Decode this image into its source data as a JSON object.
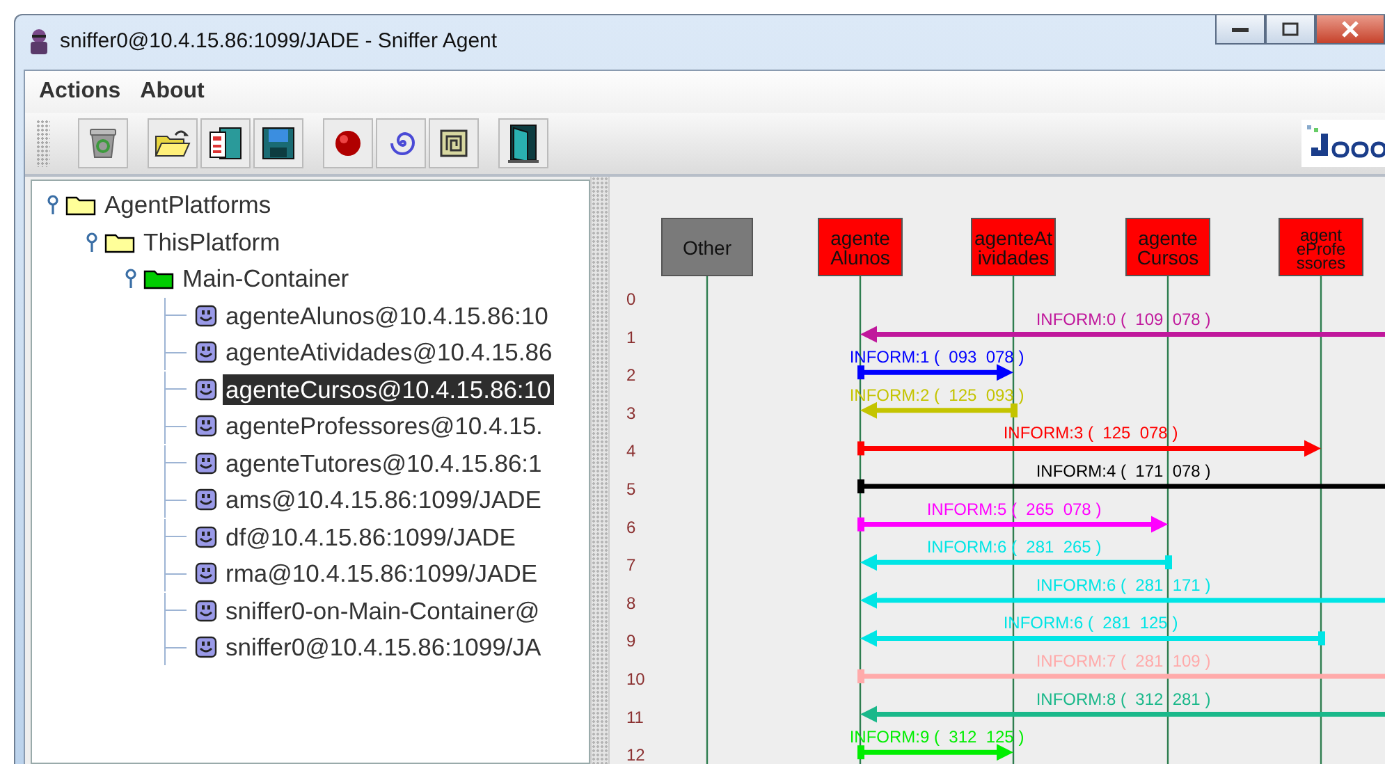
{
  "window": {
    "title": "sniffer0@10.4.15.86:1099/JADE - Sniffer Agent"
  },
  "menu": [
    "Actions",
    "About"
  ],
  "toolbar": [
    {
      "kind": "trash"
    },
    {
      "kind": "open",
      "group_start": true
    },
    {
      "kind": "document"
    },
    {
      "kind": "floppy"
    },
    {
      "kind": "record",
      "group_start": true
    },
    {
      "kind": "spiral"
    },
    {
      "kind": "square-spiral"
    },
    {
      "kind": "door",
      "group_start": true
    }
  ],
  "tree": [
    {
      "label": "AgentPlatforms",
      "kind": "folder",
      "expanded": true,
      "selected": false,
      "children": [
        {
          "label": "ThisPlatform",
          "kind": "folder",
          "expanded": true,
          "selected": false,
          "children": [
            {
              "label": "Main-Container",
              "kind": "container",
              "expanded": true,
              "selected": false,
              "children": [
                {
                  "label": "agenteAlunos@10.4.15.86:10",
                  "kind": "agent",
                  "selected": false
                },
                {
                  "label": "agenteAtividades@10.4.15.86",
                  "kind": "agent",
                  "selected": false
                },
                {
                  "label": "agenteCursos@10.4.15.86:10",
                  "kind": "agent",
                  "selected": true
                },
                {
                  "label": "agenteProfessores@10.4.15.",
                  "kind": "agent",
                  "selected": false
                },
                {
                  "label": "agenteTutores@10.4.15.86:1",
                  "kind": "agent",
                  "selected": false
                },
                {
                  "label": "ams@10.4.15.86:1099/JADE",
                  "kind": "agent",
                  "selected": false
                },
                {
                  "label": "df@10.4.15.86:1099/JADE",
                  "kind": "agent",
                  "selected": false
                },
                {
                  "label": "rma@10.4.15.86:1099/JADE",
                  "kind": "agent",
                  "selected": false
                },
                {
                  "label": "sniffer0-on-Main-Container@",
                  "kind": "agent",
                  "selected": false
                },
                {
                  "label": "sniffer0@10.4.15.86:1099/JA",
                  "kind": "agent",
                  "selected": false
                }
              ]
            }
          ]
        }
      ]
    }
  ],
  "diagram": {
    "agents": [
      {
        "name_lines": [
          "Other"
        ],
        "kind": "other"
      },
      {
        "name_lines": [
          "agente",
          "Alunos"
        ],
        "kind": "agent"
      },
      {
        "name_lines": [
          "agenteAt",
          "ividades"
        ],
        "kind": "agent"
      },
      {
        "name_lines": [
          "agente",
          "Cursos"
        ],
        "kind": "agent"
      },
      {
        "name_lines": [
          "agent",
          "eProfe",
          "ssores"
        ],
        "kind": "agent"
      }
    ],
    "row_numbers": [
      "0",
      "1",
      "2",
      "3",
      "4",
      "5",
      "6",
      "7",
      "8",
      "9",
      "10",
      "11",
      "12"
    ],
    "messages": [
      {
        "label": "INFORM:0 (  109  078 )",
        "color": "#c0189c",
        "lanes": [
          {
            "kind": "none"
          },
          {
            "kind": "head"
          },
          {
            "kind": "none"
          },
          {
            "kind": "none"
          },
          {
            "kind": "none"
          }
        ]
      },
      {
        "label": "INFORM:1 (  093  078 )",
        "color": "#0000ff",
        "lanes": [
          {
            "kind": "none"
          },
          {
            "kind": "tail"
          },
          {
            "kind": "head"
          },
          {
            "kind": "none"
          },
          {
            "kind": "none"
          }
        ]
      },
      {
        "label": "INFORM:2 (  125  093 )",
        "color": "#c4c400",
        "lanes": [
          {
            "kind": "none"
          },
          {
            "kind": "head"
          },
          {
            "kind": "tail"
          },
          {
            "kind": "none"
          },
          {
            "kind": "none"
          }
        ]
      },
      {
        "label": "INFORM:3 (  125  078 )",
        "color": "#ff0000",
        "lanes": [
          {
            "kind": "none"
          },
          {
            "kind": "tail"
          },
          {
            "kind": "none"
          },
          {
            "kind": "none"
          },
          {
            "kind": "head"
          }
        ]
      },
      {
        "label": "INFORM:4 (  171  078 )",
        "color": "#000000",
        "lanes": [
          {
            "kind": "none"
          },
          {
            "kind": "tail"
          },
          {
            "kind": "none"
          },
          {
            "kind": "none"
          },
          {
            "kind": "none"
          }
        ]
      },
      {
        "label": "INFORM:5 (  265  078 )",
        "color": "#ff00ff",
        "lanes": [
          {
            "kind": "none"
          },
          {
            "kind": "tail"
          },
          {
            "kind": "none"
          },
          {
            "kind": "head"
          },
          {
            "kind": "none"
          }
        ]
      },
      {
        "label": "INFORM:6 (  281  265 )",
        "color": "#00e5e5",
        "lanes": [
          {
            "kind": "none"
          },
          {
            "kind": "head"
          },
          {
            "kind": "none"
          },
          {
            "kind": "tail"
          },
          {
            "kind": "none"
          }
        ]
      },
      {
        "label": "INFORM:6 (  281  171 )",
        "color": "#00e5e5",
        "lanes": [
          {
            "kind": "none"
          },
          {
            "kind": "head"
          },
          {
            "kind": "none"
          },
          {
            "kind": "none"
          },
          {
            "kind": "none"
          }
        ]
      },
      {
        "label": "INFORM:6 (  281  125 )",
        "color": "#00e5e5",
        "lanes": [
          {
            "kind": "none"
          },
          {
            "kind": "head"
          },
          {
            "kind": "none"
          },
          {
            "kind": "none"
          },
          {
            "kind": "tail"
          }
        ]
      },
      {
        "label": "INFORM:7 (  281  109 )",
        "color": "#ffaaaa",
        "lanes": [
          {
            "kind": "none"
          },
          {
            "kind": "tail"
          },
          {
            "kind": "none"
          },
          {
            "kind": "none"
          },
          {
            "kind": "none"
          }
        ]
      },
      {
        "label": "INFORM:8 (  312  281 )",
        "color": "#1ab88a",
        "lanes": [
          {
            "kind": "none"
          },
          {
            "kind": "head"
          },
          {
            "kind": "none"
          },
          {
            "kind": "none"
          },
          {
            "kind": "none"
          }
        ]
      },
      {
        "label": "INFORM:9 (  312  125 )",
        "color": "#00ee00",
        "lanes": [
          {
            "kind": "none"
          },
          {
            "kind": "tail"
          },
          {
            "kind": "head"
          },
          {
            "kind": "none"
          },
          {
            "kind": "none"
          }
        ]
      }
    ]
  }
}
